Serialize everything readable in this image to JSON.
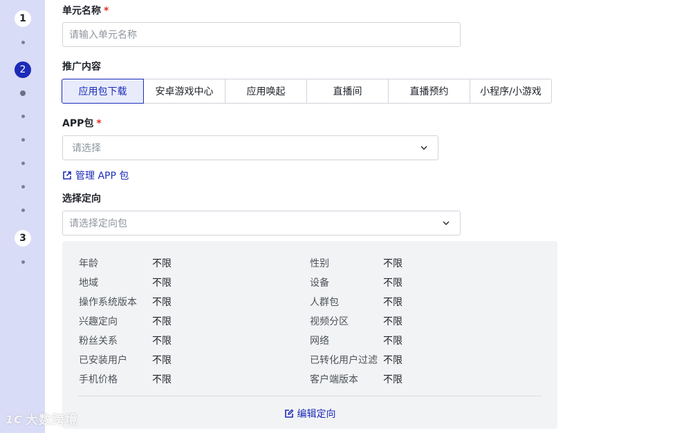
{
  "steps": [
    {
      "number": "1",
      "state": "inactive"
    },
    {
      "number": "2",
      "state": "active"
    },
    {
      "number": "3",
      "state": "inactive"
    }
  ],
  "form": {
    "unit_name": {
      "label": "单元名称",
      "required": "*",
      "placeholder": "请输入单元名称"
    },
    "promotion": {
      "label": "推广内容",
      "options": [
        "应用包下载",
        "安卓游戏中心",
        "应用唤起",
        "直播间",
        "直播预约",
        "小程序/小游戏"
      ],
      "selected": "应用包下载"
    },
    "app_package": {
      "label": "APP包",
      "required": "*",
      "placeholder": "请选择",
      "icon": "chevron-down-icon"
    },
    "manage_link": {
      "label": "管理 APP 包",
      "icon": "external-link-icon"
    },
    "targeting": {
      "label": "选择定向",
      "placeholder": "请选择定向包",
      "icon": "chevron-down-icon"
    }
  },
  "targeting_summary": {
    "left": [
      {
        "key": "年龄",
        "value": "不限"
      },
      {
        "key": "地域",
        "value": "不限"
      },
      {
        "key": "操作系统版本",
        "value": "不限"
      },
      {
        "key": "兴趣定向",
        "value": "不限"
      },
      {
        "key": "粉丝关系",
        "value": "不限"
      },
      {
        "key": "已安装用户",
        "value": "不限"
      },
      {
        "key": "手机价格",
        "value": "不限"
      }
    ],
    "right": [
      {
        "key": "性别",
        "value": "不限"
      },
      {
        "key": "设备",
        "value": "不限"
      },
      {
        "key": "人群包",
        "value": "不限"
      },
      {
        "key": "视频分区",
        "value": "不限"
      },
      {
        "key": "网络",
        "value": "不限"
      },
      {
        "key": "已转化用户过滤",
        "value": "不限"
      },
      {
        "key": "客户端版本",
        "value": "不限"
      }
    ],
    "edit_label": "编辑定向",
    "edit_icon": "edit-icon"
  },
  "watermark": {
    "mark": "1C",
    "text": "大数跨境"
  },
  "colors": {
    "accent": "#1c2bb8",
    "required": "#e0322b",
    "rail": "#d9dcf6"
  }
}
